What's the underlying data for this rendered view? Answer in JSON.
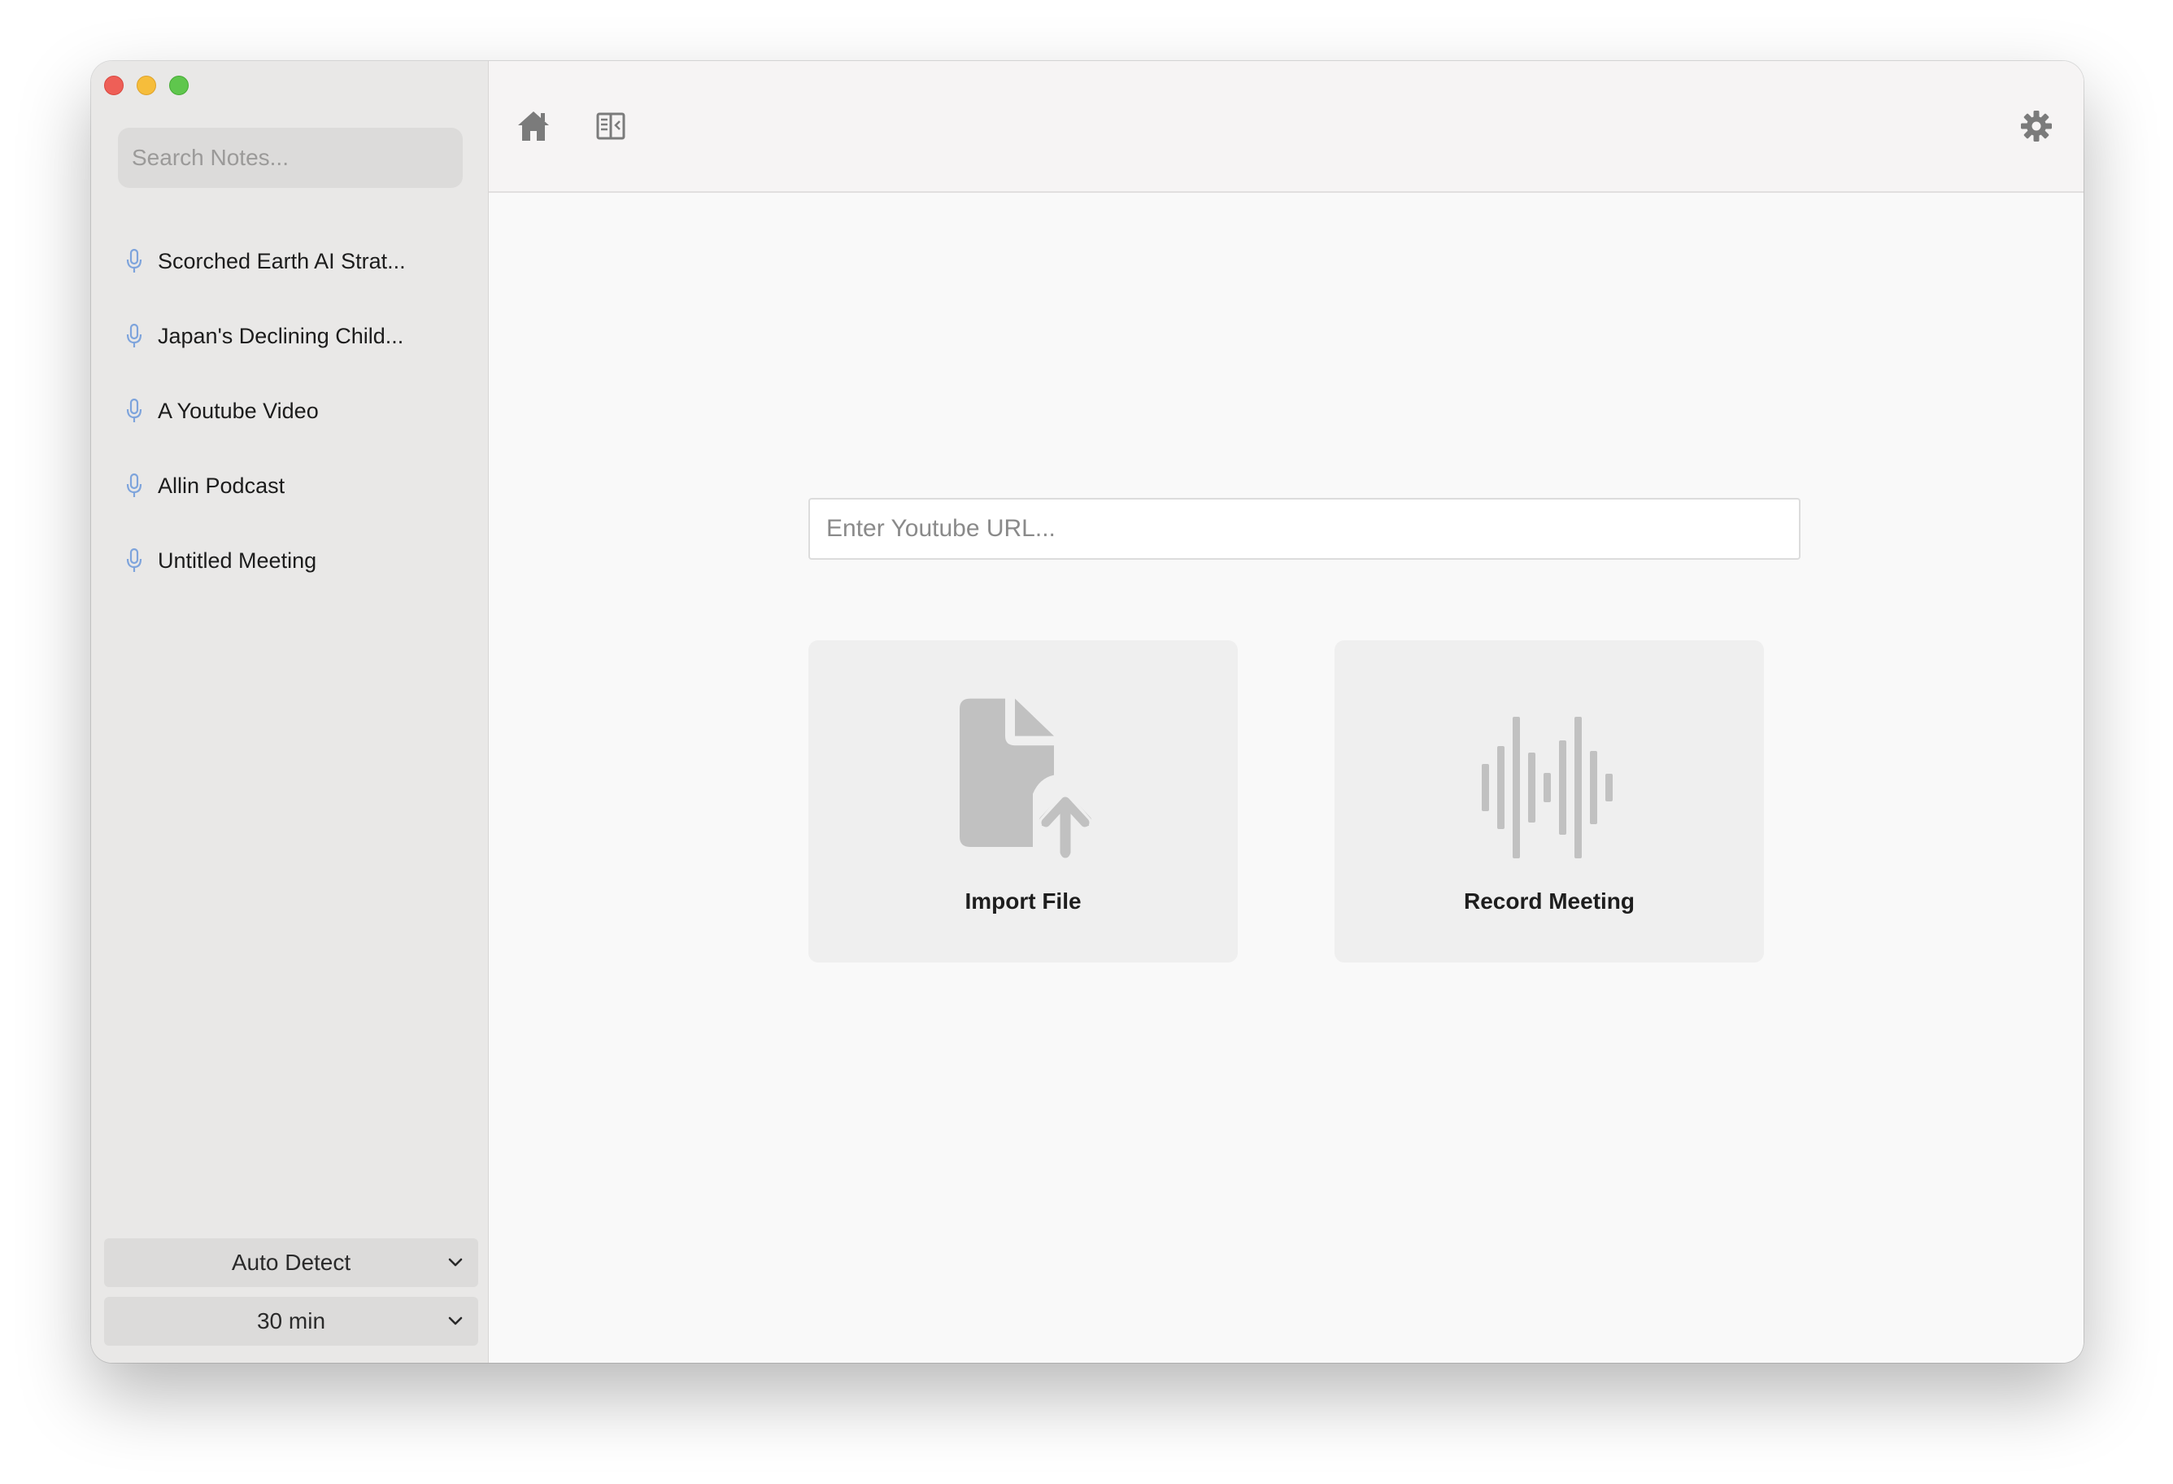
{
  "sidebar": {
    "search": {
      "placeholder": "Search Notes..."
    },
    "notes": [
      {
        "label": "Scorched Earth AI Strat..."
      },
      {
        "label": "Japan's Declining Child..."
      },
      {
        "label": "A Youtube Video"
      },
      {
        "label": "Allin Podcast"
      },
      {
        "label": "Untitled Meeting"
      }
    ],
    "language_select": {
      "value": "Auto Detect"
    },
    "duration_select": {
      "value": "30 min"
    }
  },
  "main": {
    "url_input": {
      "placeholder": "Enter Youtube URL..."
    },
    "cards": {
      "import": {
        "label": "Import File"
      },
      "record": {
        "label": "Record Meeting"
      }
    }
  },
  "icons": {
    "note": "microphone-icon",
    "home": "home-icon",
    "panel": "sidebar-toggle-icon",
    "settings": "gear-icon",
    "import": "file-upload-icon",
    "record": "audio-waveform-icon",
    "chevron": "chevron-down-icon"
  },
  "colors": {
    "sidebar_bg": "#e9e8e7",
    "main_bg": "#f9f9f9",
    "card_bg": "#efefef",
    "icon_gray": "#c1c1c1",
    "mic_blue": "#7ea4dc"
  }
}
